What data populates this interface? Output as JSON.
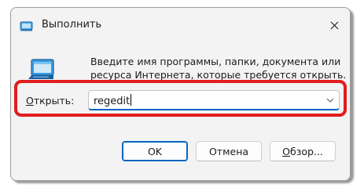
{
  "window": {
    "title": "Выполнить",
    "close_icon": "close-icon"
  },
  "description": "Введите имя программы, папки, документа или ресурса Интернета, которые требуется открыть.",
  "open_field": {
    "label_underlined": "О",
    "label_rest": "ткрыть:",
    "value": "regedit"
  },
  "buttons": {
    "ok": "OK",
    "cancel": "Отмена",
    "browse_underlined": "О",
    "browse_rest": "бзор..."
  },
  "colors": {
    "highlight": "#e21d1d",
    "accent": "#0067c0"
  }
}
